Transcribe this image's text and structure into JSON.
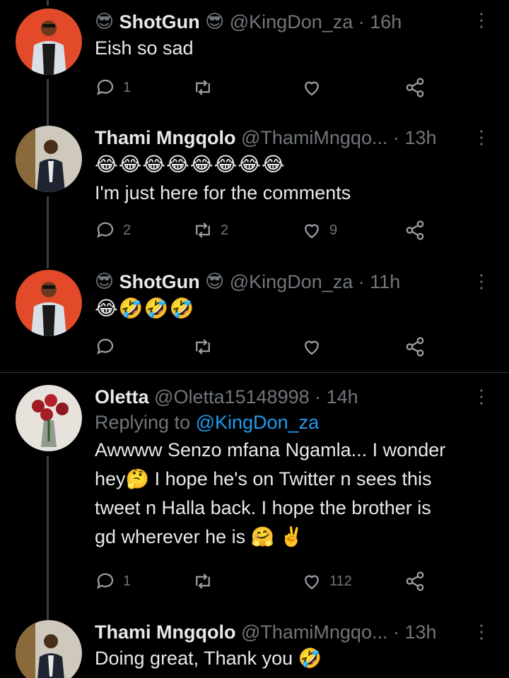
{
  "tweets": [
    {
      "name": "ShotGun",
      "name_prefix_emoji": "😎",
      "name_suffix_emoji": "😎",
      "handle": "@KingDon_za",
      "time": "· 16h",
      "text": "Eish so sad",
      "replies": "1",
      "retweets": "",
      "likes": ""
    },
    {
      "name": "Thami Mngqolo",
      "handle": "@ThamiMngqo...",
      "time": "· 13h",
      "emoji_line": "😂😂😂😂😂😂😂😂",
      "text": "I'm just here for the comments",
      "replies": "2",
      "retweets": "2",
      "likes": "9"
    },
    {
      "name": "ShotGun",
      "name_prefix_emoji": "😎",
      "name_suffix_emoji": "😎",
      "handle": "@KingDon_za",
      "time": "· 11h",
      "emoji_line": "😂🤣🤣🤣",
      "replies": "",
      "retweets": "",
      "likes": ""
    },
    {
      "name": "Oletta",
      "handle": "@Oletta15148998",
      "time": "· 14h",
      "replying_prefix": "Replying to",
      "replying_to": "@KingDon_za",
      "text_lines": [
        "Awwww Senzo mfana Ngamla... I wonder",
        "hey🤔 I hope he's on Twitter n sees this",
        "tweet n Halla back. I  hope the brother is",
        "gd wherever he is 🤗 ✌"
      ],
      "replies": "1",
      "retweets": "",
      "likes": "112"
    },
    {
      "name": "Thami Mngqolo",
      "handle": "@ThamiMngqo...",
      "time": "· 13h",
      "text": "Doing great, Thank you 🤣"
    }
  ],
  "icons": {
    "more": "more-vertical-icon",
    "reply": "reply-icon",
    "retweet": "retweet-icon",
    "like": "heart-icon",
    "share": "share-icon"
  },
  "colors": {
    "background": "#000000",
    "text": "#e7e9ea",
    "muted": "#71767b",
    "link": "#1d9bf0",
    "divider": "#2f3336"
  }
}
